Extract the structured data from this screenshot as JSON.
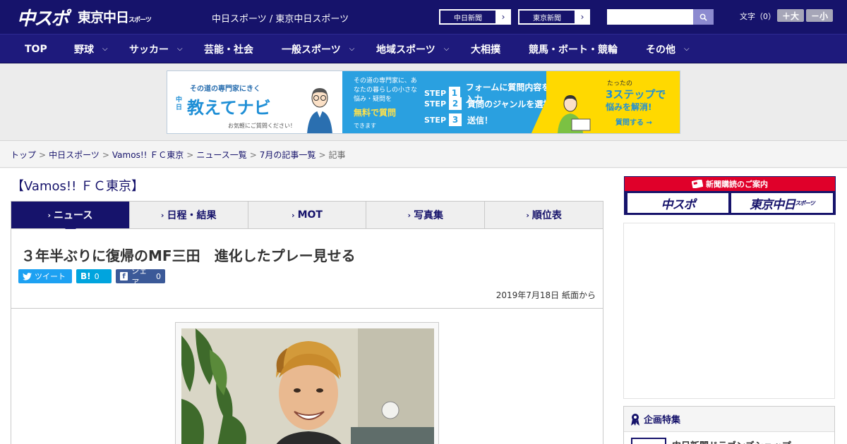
{
  "header": {
    "logo_chuspo": "中スポ",
    "logo_tokyo": "東京中日",
    "logo_tokyo_small": "スポーツ",
    "site_names": "中日スポーツ / 東京中日スポーツ",
    "paper_links": [
      {
        "label": "中日新聞",
        "arrow": "›"
      },
      {
        "label": "東京新聞",
        "arrow": "›"
      }
    ],
    "search_placeholder": "",
    "text_size_label": "文字（0）",
    "text_larger": "＋大",
    "text_smaller": "－小"
  },
  "nav": [
    {
      "label": "TOP",
      "has_menu": false
    },
    {
      "label": "野球",
      "has_menu": true
    },
    {
      "label": "サッカー",
      "has_menu": true
    },
    {
      "label": "芸能・社会",
      "has_menu": false
    },
    {
      "label": "一般スポーツ",
      "has_menu": true
    },
    {
      "label": "地域スポーツ",
      "has_menu": true
    },
    {
      "label": "大相撲",
      "has_menu": false
    },
    {
      "label": "競馬・ボート・競輪",
      "has_menu": false
    },
    {
      "label": "その他",
      "has_menu": true
    }
  ],
  "nav_chevron": "⌵",
  "ad_banner": {
    "tagline": "その道の専門家にきく",
    "brand_prefix": "中日",
    "title": "教えてナビ",
    "sub": "お気軽にご質問ください！",
    "mid_text": "その道の専門家に、あなたの暮らしの小さな悩み・疑問を",
    "mid_highlight": "無料で質問",
    "mid_foot": "できます",
    "steps": [
      {
        "step": "STEP",
        "num": "1",
        "text": "フォームに質問内容を入力"
      },
      {
        "step": "STEP",
        "num": "2",
        "text": "質問のジャンルを選択"
      },
      {
        "step": "STEP",
        "num": "3",
        "text": "送信！"
      }
    ],
    "right_small": "たったの",
    "right_big": "3ステップで",
    "right_mid": "悩みを解消!",
    "right_cta": "質問する →"
  },
  "breadcrumb": [
    {
      "label": "トップ",
      "link": true
    },
    {
      "label": "中日スポーツ",
      "link": true
    },
    {
      "label": "Vamos!! ＦＣ東京",
      "link": true
    },
    {
      "label": "ニュース一覧",
      "link": true
    },
    {
      "label": "7月の記事一覧",
      "link": true
    },
    {
      "label": "記事",
      "link": false
    }
  ],
  "breadcrumb_sep": ">",
  "section_title": "【Vamos!! ＦＣ東京】",
  "tabs": [
    {
      "label": "ニュース",
      "active": true
    },
    {
      "label": "日程・結果",
      "active": false
    },
    {
      "label": "MOT",
      "active": false
    },
    {
      "label": "写真集",
      "active": false
    },
    {
      "label": "順位表",
      "active": false
    }
  ],
  "tab_chevron": "›",
  "article": {
    "headline": "３年半ぶりに復帰のMF三田　進化したプレー見せる",
    "share_tweet": "ツイート",
    "share_hatena": "0",
    "share_fb": "シェア",
    "share_fb_count": "0",
    "date": "2019年7月18日 紙面から"
  },
  "sidebar": {
    "subscribe_label": "新聞購読のご案内",
    "sub_logo_1": "中スポ",
    "sub_logo_2": "東京中日",
    "sub_logo_2_small": "スポーツ",
    "feature_title": "企画特集",
    "feature_item": "中日新聞ドラゴンズショップ"
  },
  "colors": {
    "brand_navy": "#16136b",
    "nav_bg": "#1e1a7c",
    "accent_red": "#e0002a",
    "twitter": "#1da1f2",
    "hatena": "#00a4de",
    "facebook": "#3b5998"
  }
}
